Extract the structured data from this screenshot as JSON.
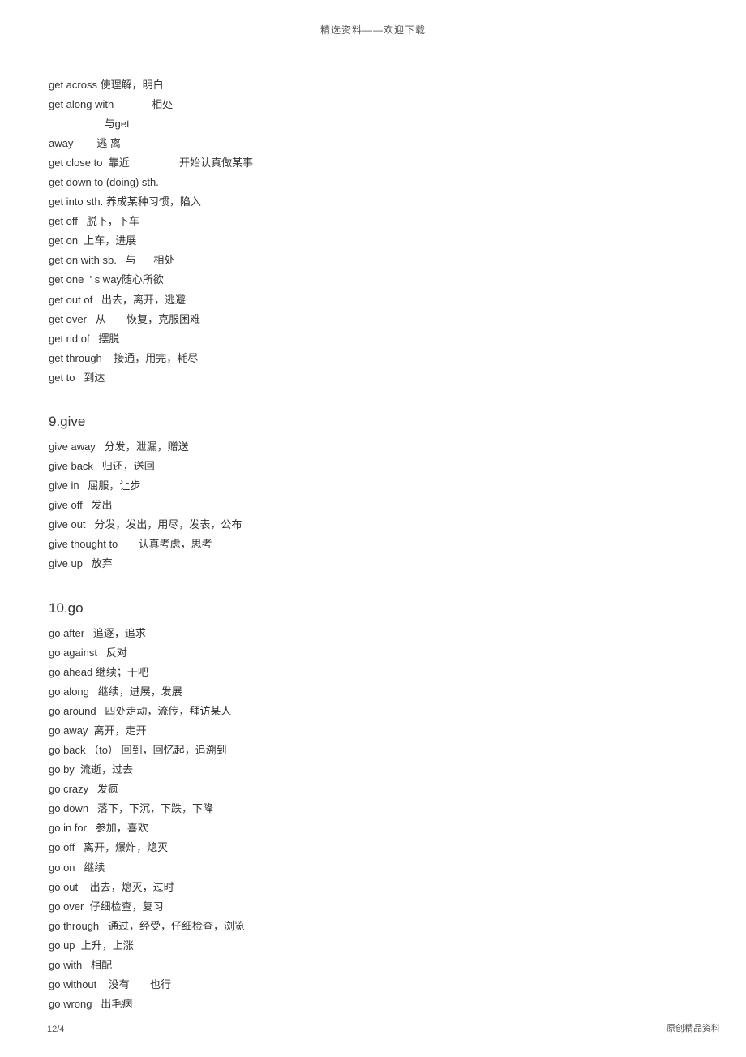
{
  "header": "精选资料——欢迎下载",
  "sections": [
    {
      "heading": null,
      "entries": [
        "get across 使理解，明白",
        "get along with             相处",
        "                   与get",
        "away        逃 离",
        "get close to  靠近                 开始认真做某事",
        "get down to (doing) sth.",
        "get into sth. 养成某种习惯，陷入",
        "get off   脱下，下车",
        "get on  上车，进展",
        "get on with sb.   与      相处",
        "get one  ' s way随心所欲",
        "get out of   出去，离开，逃避",
        "get over   从       恢复，克服困难",
        "get rid of   摆脱",
        "get through    接通，用完，耗尽",
        "get to   到达"
      ]
    },
    {
      "heading": "9.give",
      "entries": [
        "give away   分发，泄漏，赠送",
        "give back   归还，送回",
        "give in   屈服，让步",
        "give off   发出",
        "give out   分发，发出，用尽，发表，公布",
        "give thought to       认真考虑，思考",
        "give up   放弃"
      ]
    },
    {
      "heading": "10.go",
      "entries": [
        "go after   追逐，追求",
        "go against   反对",
        "go ahead 继续；干吧",
        "go along   继续，进展，发展",
        "go around   四处走动，流传，拜访某人",
        "go away  离开，走开",
        "go back （to） 回到，回忆起，追溯到",
        "go by  流逝，过去",
        "go crazy   发疯",
        "go down   落下，下沉，下跌，下降",
        "go in for   参加，喜欢",
        "go off   离开，爆炸，熄灭",
        "go on   继续",
        "go out    出去，熄灭，过时",
        "go over  仔细检查，复习",
        "go through   通过，经受，仔细检查，浏览",
        "go up  上升，上涨",
        "go with   相配",
        "go without    没有       也行",
        "go wrong   出毛病"
      ]
    }
  ],
  "footer": {
    "page": "12/4",
    "right": "原创精品资料"
  }
}
